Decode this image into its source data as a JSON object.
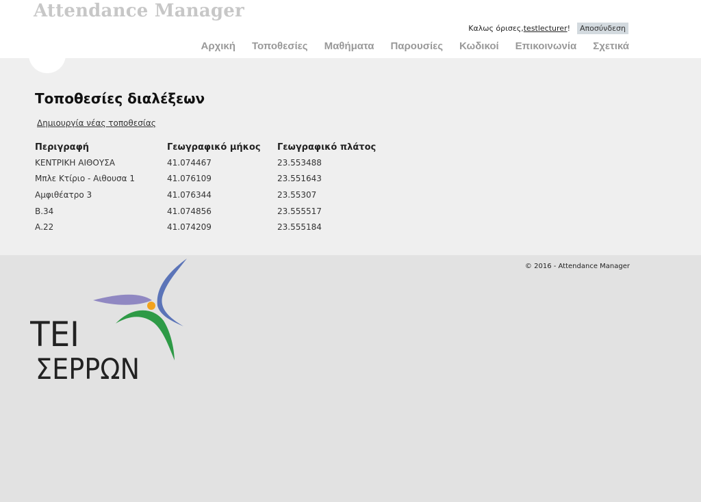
{
  "header": {
    "site_title": "Attendance Manager",
    "welcome_prefix": "Καλως όρισες, ",
    "username": "testlecturer",
    "welcome_suffix": "!",
    "logout_label": "Αποσύνδεση"
  },
  "nav": {
    "items": [
      {
        "label": "Αρχική"
      },
      {
        "label": "Τοποθεσίες"
      },
      {
        "label": "Μαθήματα"
      },
      {
        "label": "Παρουσίες"
      },
      {
        "label": "Κωδικοί"
      },
      {
        "label": "Επικοινωνία"
      },
      {
        "label": "Σχετικά"
      }
    ]
  },
  "main": {
    "title": "Τοποθεσίες διαλέξεων",
    "create_link": "Δημιουργία νέας τοποθεσίας",
    "columns": [
      "Περιγραφή",
      "Γεωγραφικό μήκος",
      "Γεωγραφικό πλάτος"
    ],
    "rows": [
      [
        "ΚΕΝΤΡΙΚΗ ΑΙΘΟΥΣΑ",
        "41.074467",
        "23.553488"
      ],
      [
        "Μπλε Κτίριο - Αιθουσα 1",
        "41.076109",
        "23.551643"
      ],
      [
        "Αμφιθέατρο 3",
        "41.076344",
        "23.55307"
      ],
      [
        "Β.34",
        "41.074856",
        "23.555517"
      ],
      [
        "Α.22",
        "41.074209",
        "23.555184"
      ]
    ]
  },
  "footer": {
    "copyright": "© 2016 - Attendance Manager",
    "logo_text_line1": "ΤΕΙ",
    "logo_text_line2": "ΣΕΡΡΩΝ"
  },
  "colors": {
    "header_bg": "#ffffff",
    "main_bg": "#efefef",
    "footer_bg": "#e2e2e2",
    "nav_text": "#999999",
    "logout_bg": "#d3dadf"
  }
}
